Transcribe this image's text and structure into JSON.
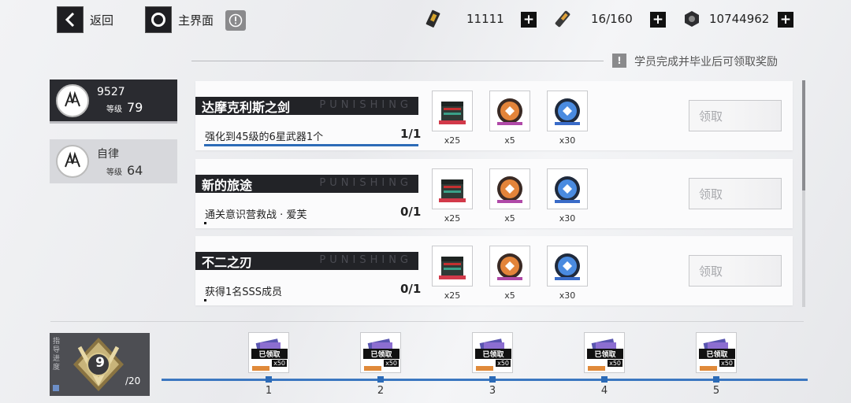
{
  "top_bar": {
    "back_label": "返回",
    "home_label": "主界面",
    "resources": [
      {
        "icon": "stamina-pass-icon",
        "value": "11111"
      },
      {
        "icon": "stamina-battery-icon",
        "value": "16/160"
      },
      {
        "icon": "currency-coin-icon",
        "value": "10744962"
      }
    ]
  },
  "hint": {
    "text": "学员完成并毕业后可领取奖励"
  },
  "students": [
    {
      "name": "9527",
      "level_label": "等级",
      "level": "79",
      "active": true
    },
    {
      "name": "自律",
      "level_label": "等级",
      "level": "64",
      "active": false
    }
  ],
  "watermark": "PUNISHING",
  "tasks": [
    {
      "title": "达摩克利斯之剑",
      "desc": "强化到45级的6星武器1个",
      "progress": "1/1",
      "progress_fraction": 1.0,
      "claim_label": "领取",
      "rewards": [
        {
          "icon": "supply-chest-icon",
          "qty": "x25"
        },
        {
          "icon": "orange-token-icon",
          "qty": "x5"
        },
        {
          "icon": "blue-token-icon",
          "qty": "x30"
        }
      ]
    },
    {
      "title": "新的旅途",
      "desc": "通关意识营救战 · 爱芙",
      "progress": "0/1",
      "progress_fraction": 0.0,
      "claim_label": "领取",
      "rewards": [
        {
          "icon": "supply-chest-icon",
          "qty": "x25"
        },
        {
          "icon": "orange-token-icon",
          "qty": "x5"
        },
        {
          "icon": "blue-token-icon",
          "qty": "x30"
        }
      ]
    },
    {
      "title": "不二之刃",
      "desc": "获得1名SSS成员",
      "progress": "0/1",
      "progress_fraction": 0.0,
      "claim_label": "领取",
      "rewards": [
        {
          "icon": "supply-chest-icon",
          "qty": "x25"
        },
        {
          "icon": "orange-token-icon",
          "qty": "x5"
        },
        {
          "icon": "blue-token-icon",
          "qty": "x30"
        }
      ]
    }
  ],
  "guide": {
    "side_label": "指导进度",
    "level": "9",
    "max": "/20"
  },
  "milestones": [
    {
      "num": "1",
      "badge": "已领取",
      "qty": "x50"
    },
    {
      "num": "2",
      "badge": "已领取",
      "qty": "x50"
    },
    {
      "num": "3",
      "badge": "已领取",
      "qty": "x50"
    },
    {
      "num": "4",
      "badge": "已领取",
      "qty": "x50"
    },
    {
      "num": "5",
      "badge": "已领取",
      "qty": "x50"
    }
  ],
  "colors": {
    "accent": "#2c6bb7",
    "dark": "#222327"
  }
}
